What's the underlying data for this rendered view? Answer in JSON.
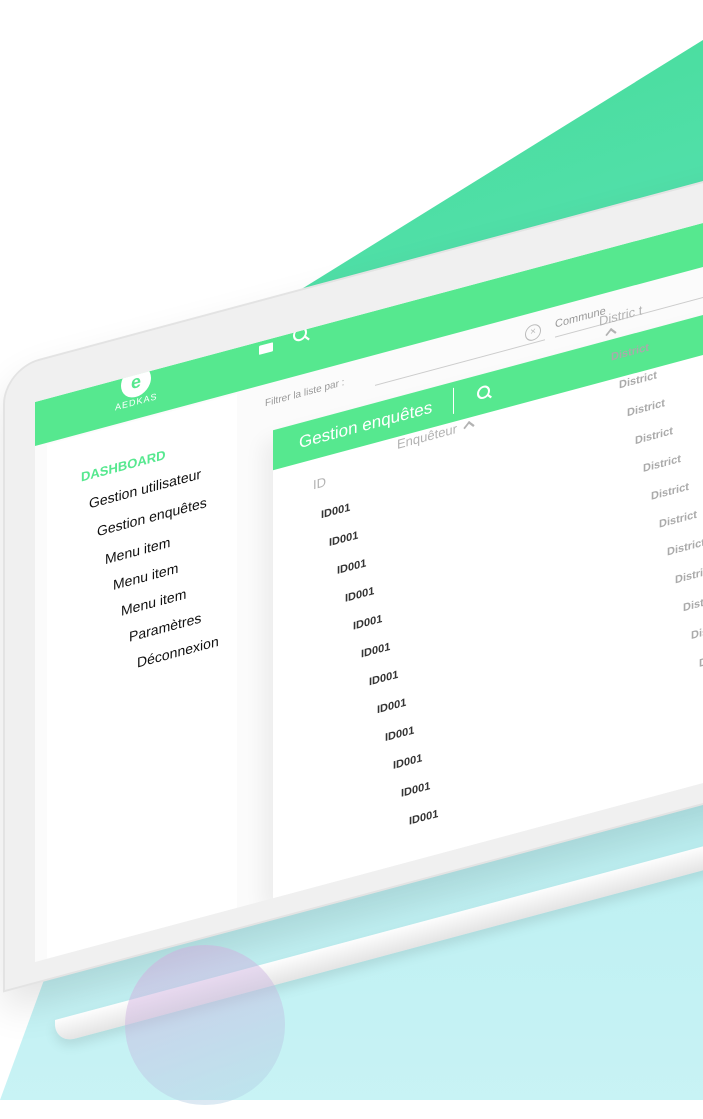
{
  "app": {
    "logo_text": "AEDKAS",
    "logo_glyph": "e"
  },
  "sidebar": {
    "items": [
      {
        "label": "DASHBOARD"
      },
      {
        "label": "Gestion utilisateur"
      },
      {
        "label": "Gestion enquêtes"
      },
      {
        "label": "Menu item"
      },
      {
        "label": "Menu item"
      },
      {
        "label": "Menu item"
      },
      {
        "label": "Paramètres"
      },
      {
        "label": "Déconnexion"
      }
    ]
  },
  "filters": {
    "label": "Filtrer la liste par :",
    "commune_placeholder": "Commune"
  },
  "card": {
    "title": "Gestion enquêtes"
  },
  "table": {
    "columns": {
      "id": "ID",
      "enqueteur": "Enquêteur",
      "district": "Distric t"
    },
    "rows": [
      {
        "id": "ID001",
        "district": "District"
      },
      {
        "id": "ID001",
        "district": "District"
      },
      {
        "id": "ID001",
        "district": "District"
      },
      {
        "id": "ID001",
        "district": "District"
      },
      {
        "id": "ID001",
        "district": "District"
      },
      {
        "id": "ID001",
        "district": "District"
      },
      {
        "id": "ID001",
        "district": "District"
      },
      {
        "id": "ID001",
        "district": "District"
      },
      {
        "id": "ID001",
        "district": "District"
      },
      {
        "id": "ID001",
        "district": "District"
      },
      {
        "id": "ID001",
        "district": "District"
      },
      {
        "id": "ID001",
        "district": "District"
      }
    ]
  },
  "colors": {
    "accent": "#56e88f",
    "background_shape": "#4fdca0"
  },
  "icons": [
    "menu-icon",
    "search-icon",
    "clear-icon",
    "chevron-up-icon"
  ]
}
